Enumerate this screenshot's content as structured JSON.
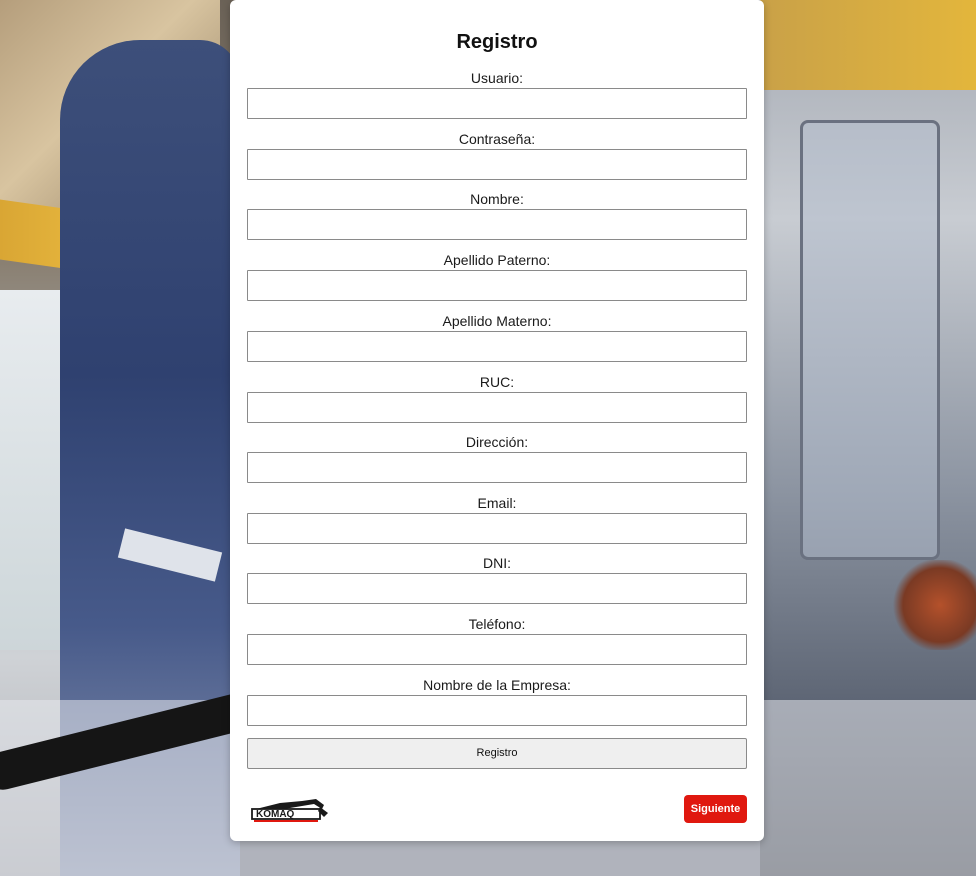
{
  "form": {
    "title": "Registro",
    "fields": [
      {
        "label": "Usuario:",
        "value": "",
        "placeholder": ""
      },
      {
        "label": "Contraseña:",
        "value": "",
        "placeholder": ""
      },
      {
        "label": "Nombre:",
        "value": "",
        "placeholder": ""
      },
      {
        "label": "Apellido Paterno:",
        "value": "",
        "placeholder": ""
      },
      {
        "label": "Apellido Materno:",
        "value": "",
        "placeholder": ""
      },
      {
        "label": "RUC:",
        "value": "",
        "placeholder": ""
      },
      {
        "label": "Dirección:",
        "value": "",
        "placeholder": ""
      },
      {
        "label": "Email:",
        "value": "",
        "placeholder": ""
      },
      {
        "label": "DNI:",
        "value": "",
        "placeholder": ""
      },
      {
        "label": "Teléfono:",
        "value": "",
        "placeholder": ""
      },
      {
        "label": "Nombre de la Empresa:",
        "value": "",
        "placeholder": ""
      }
    ],
    "submit_label": "Registro",
    "next_label": "Siguiente"
  },
  "brand": {
    "logo_text": "KOMAQ",
    "logo_icon": "excavator-logo",
    "accent_color": "#e0180f"
  }
}
